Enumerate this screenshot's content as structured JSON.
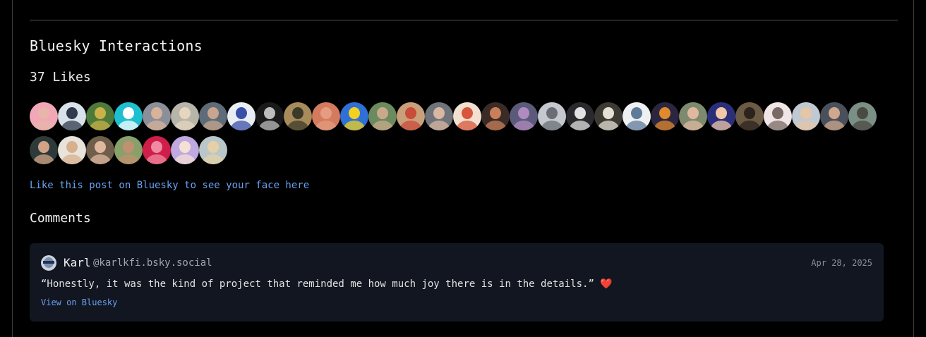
{
  "interactions": {
    "title": "Bluesky Interactions",
    "likes_label": "37 Likes",
    "like_prompt": "Like this post on Bluesky to see your face here",
    "likers": [
      {
        "bg": "#f2a7b7",
        "fg": "#e7b6a8"
      },
      {
        "bg": "#d9e2ea",
        "fg": "#2f3b4c"
      },
      {
        "bg": "#4d7a3b",
        "fg": "#c9b24a"
      },
      {
        "bg": "#1ec0cf",
        "fg": "#ffffff"
      },
      {
        "bg": "#8a8f99",
        "fg": "#d8b29a"
      },
      {
        "bg": "#b7b4a9",
        "fg": "#e6d6c0"
      },
      {
        "bg": "#5e6b78",
        "fg": "#c7a58e"
      },
      {
        "bg": "#e9eef5",
        "fg": "#3a4fa8"
      },
      {
        "bg": "#1a1a1a",
        "fg": "#bdbdbd"
      },
      {
        "bg": "#a88b5a",
        "fg": "#3b3a2a"
      },
      {
        "bg": "#d47a5e",
        "fg": "#e49d80"
      },
      {
        "bg": "#2f6fd6",
        "fg": "#f2d21e"
      },
      {
        "bg": "#6b8a5d",
        "fg": "#c9a98c"
      },
      {
        "bg": "#caa07b",
        "fg": "#c94b3a"
      },
      {
        "bg": "#6f737a",
        "fg": "#d9b7a3"
      },
      {
        "bg": "#f3e0d0",
        "fg": "#d8563b"
      },
      {
        "bg": "#3b2b26",
        "fg": "#c9805a"
      },
      {
        "bg": "#5b5a7a",
        "fg": "#b18bc0"
      },
      {
        "bg": "#c5c9cf",
        "fg": "#6a6d75"
      },
      {
        "bg": "#2a2a2e",
        "fg": "#e2e2e2"
      },
      {
        "bg": "#3d3a33",
        "fg": "#e5e0d6"
      },
      {
        "bg": "#eef0f2",
        "fg": "#5e7b9a"
      },
      {
        "bg": "#2c2540",
        "fg": "#e08a2e"
      },
      {
        "bg": "#7d8a6e",
        "fg": "#e0b8a0"
      },
      {
        "bg": "#2b2f7a",
        "fg": "#f0c8a8"
      },
      {
        "bg": "#6b5a44",
        "fg": "#2c241c"
      },
      {
        "bg": "#f0e6e6",
        "fg": "#7a6a66"
      },
      {
        "bg": "#c0c8d2",
        "fg": "#e6c6a6"
      },
      {
        "bg": "#4a505b",
        "fg": "#cfa88e"
      },
      {
        "bg": "#7a8f86",
        "fg": "#4a4a40"
      },
      {
        "bg": "#2e3a3a",
        "fg": "#d1a486"
      },
      {
        "bg": "#e8e4dc",
        "fg": "#d8b08e"
      },
      {
        "bg": "#6e5e4a",
        "fg": "#e0b8a0"
      },
      {
        "bg": "#8aa06a",
        "fg": "#c09070"
      },
      {
        "bg": "#d01e4a",
        "fg": "#f08aa0"
      },
      {
        "bg": "#c0a8e0",
        "fg": "#f5e0d6"
      },
      {
        "bg": "#b9c7c9",
        "fg": "#e6d0a8"
      }
    ]
  },
  "comments": {
    "title": "Comments",
    "items": [
      {
        "author_name": "Karl",
        "author_handle": "@karlkfi.bsky.social",
        "date": "Apr 28, 2025",
        "text": "“Honestly, it was the kind of project that reminded me how much joy there is in the details.”",
        "emoji": "❤️",
        "view_link": "View on Bluesky"
      }
    ]
  }
}
